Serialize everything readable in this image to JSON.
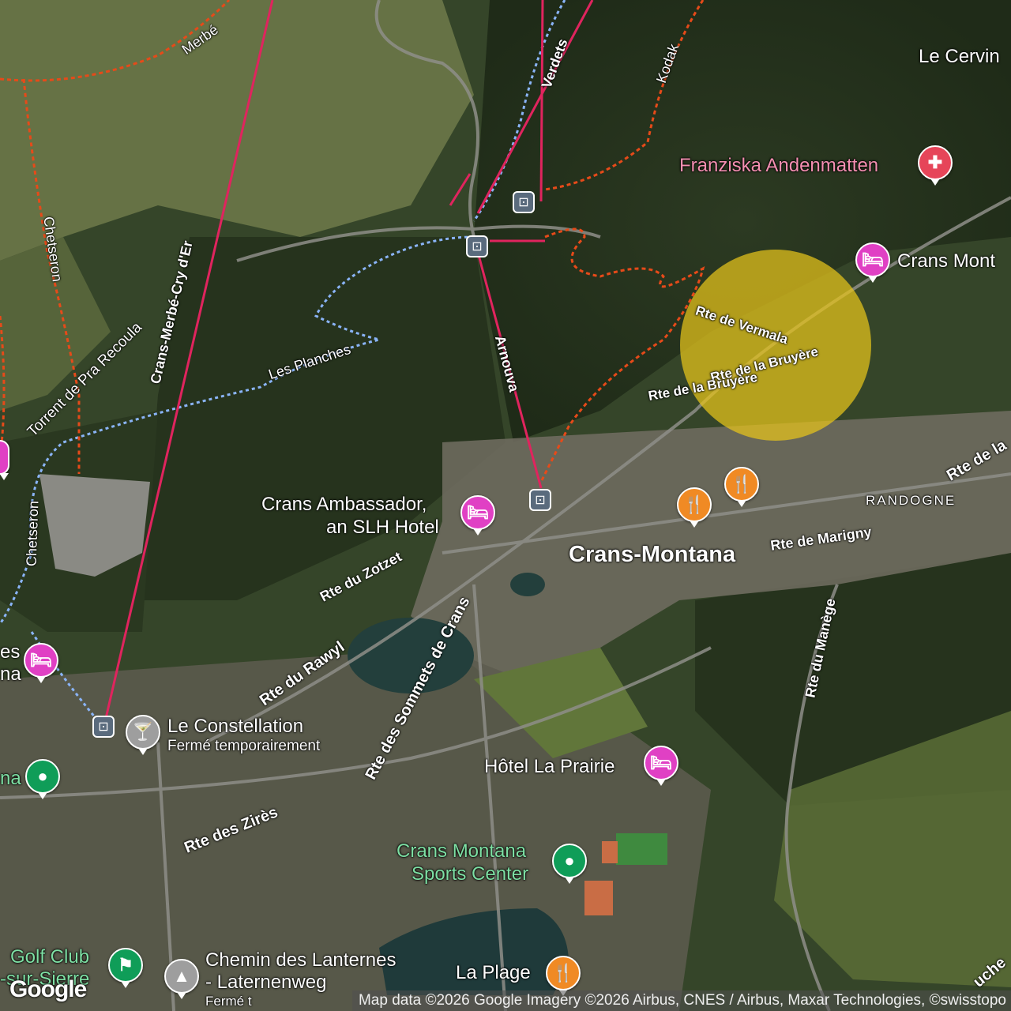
{
  "map": {
    "place": "Crans-Montana",
    "district_label": "RANDOGNE",
    "roads": {
      "vermala": "Rte de Vermala",
      "bruyere": "Rte de la Bruyère",
      "bruyere2": "Rte de la Bruyère",
      "zotzet": "Rte du Zotzet",
      "rawyl": "Rte du Rawyl",
      "sommets": "Rte des Sommets de Crans",
      "zires": "Rte des Zirès",
      "marigny": "Rte de Marigny",
      "manege": "Rte du Manège",
      "rte_de_la": "Rte de la",
      "tuche": "uche"
    },
    "trails": {
      "merbe": "Merbé",
      "verdets": "Verdets",
      "kodak": "Kodak",
      "chetseron": "Chetseron",
      "chetseron2": "Chetseron",
      "pra_recoula": "Torrent de Pra Recoula",
      "les_planches": "Les Planches",
      "cry_der": "Crans-Merbé-Cry d'Er",
      "arnouva": "Arnouva"
    },
    "pois": {
      "le_cervin": "Le Cervin",
      "franziska": "Franziska Andenmatten",
      "crans_mont": "Crans Mont",
      "ambassador_line1": "Crans Ambassador,",
      "ambassador_line2": "an SLH Hotel",
      "constellation": "Le Constellation",
      "constellation_status": "Fermé temporairement",
      "la_prairie": "Hôtel La Prairie",
      "sports_line1": "Crans Montana",
      "sports_line2": "Sports Center",
      "la_plage": "La Plage",
      "golf_line1": "Golf Club",
      "golf_line2": "-sur-Sierre",
      "lanternes_line1": "Chemin des Lanternes",
      "lanternes_line2": "- Laternenweg",
      "lanternes_status": "Fermé t",
      "left_es": "es",
      "left_na": "na",
      "left_na2": "na"
    },
    "attribution": "Map data ©2026 Google Imagery ©2026 Airbus, CNES / Airbus, Maxar Technologies, ©swisstopo",
    "logo": "Google",
    "icons": {
      "hotel": "hotel-bed-icon",
      "restaurant": "fork-knife-icon",
      "bar": "cocktail-glass-icon",
      "park": "park-pin-icon",
      "hospital": "hospital-cross-icon",
      "gondola": "gondola-icon",
      "golf": "golf-flag-icon",
      "tree": "tree-icon"
    },
    "colors": {
      "lift_line": "#e0245e",
      "dotted_trail": "#e64a19",
      "blue_trail": "#8ab4f8",
      "highlight": "#e8c51a",
      "hotel": "#e040c4",
      "restaurant": "#f08a24",
      "green_poi": "#0f9d58"
    }
  }
}
